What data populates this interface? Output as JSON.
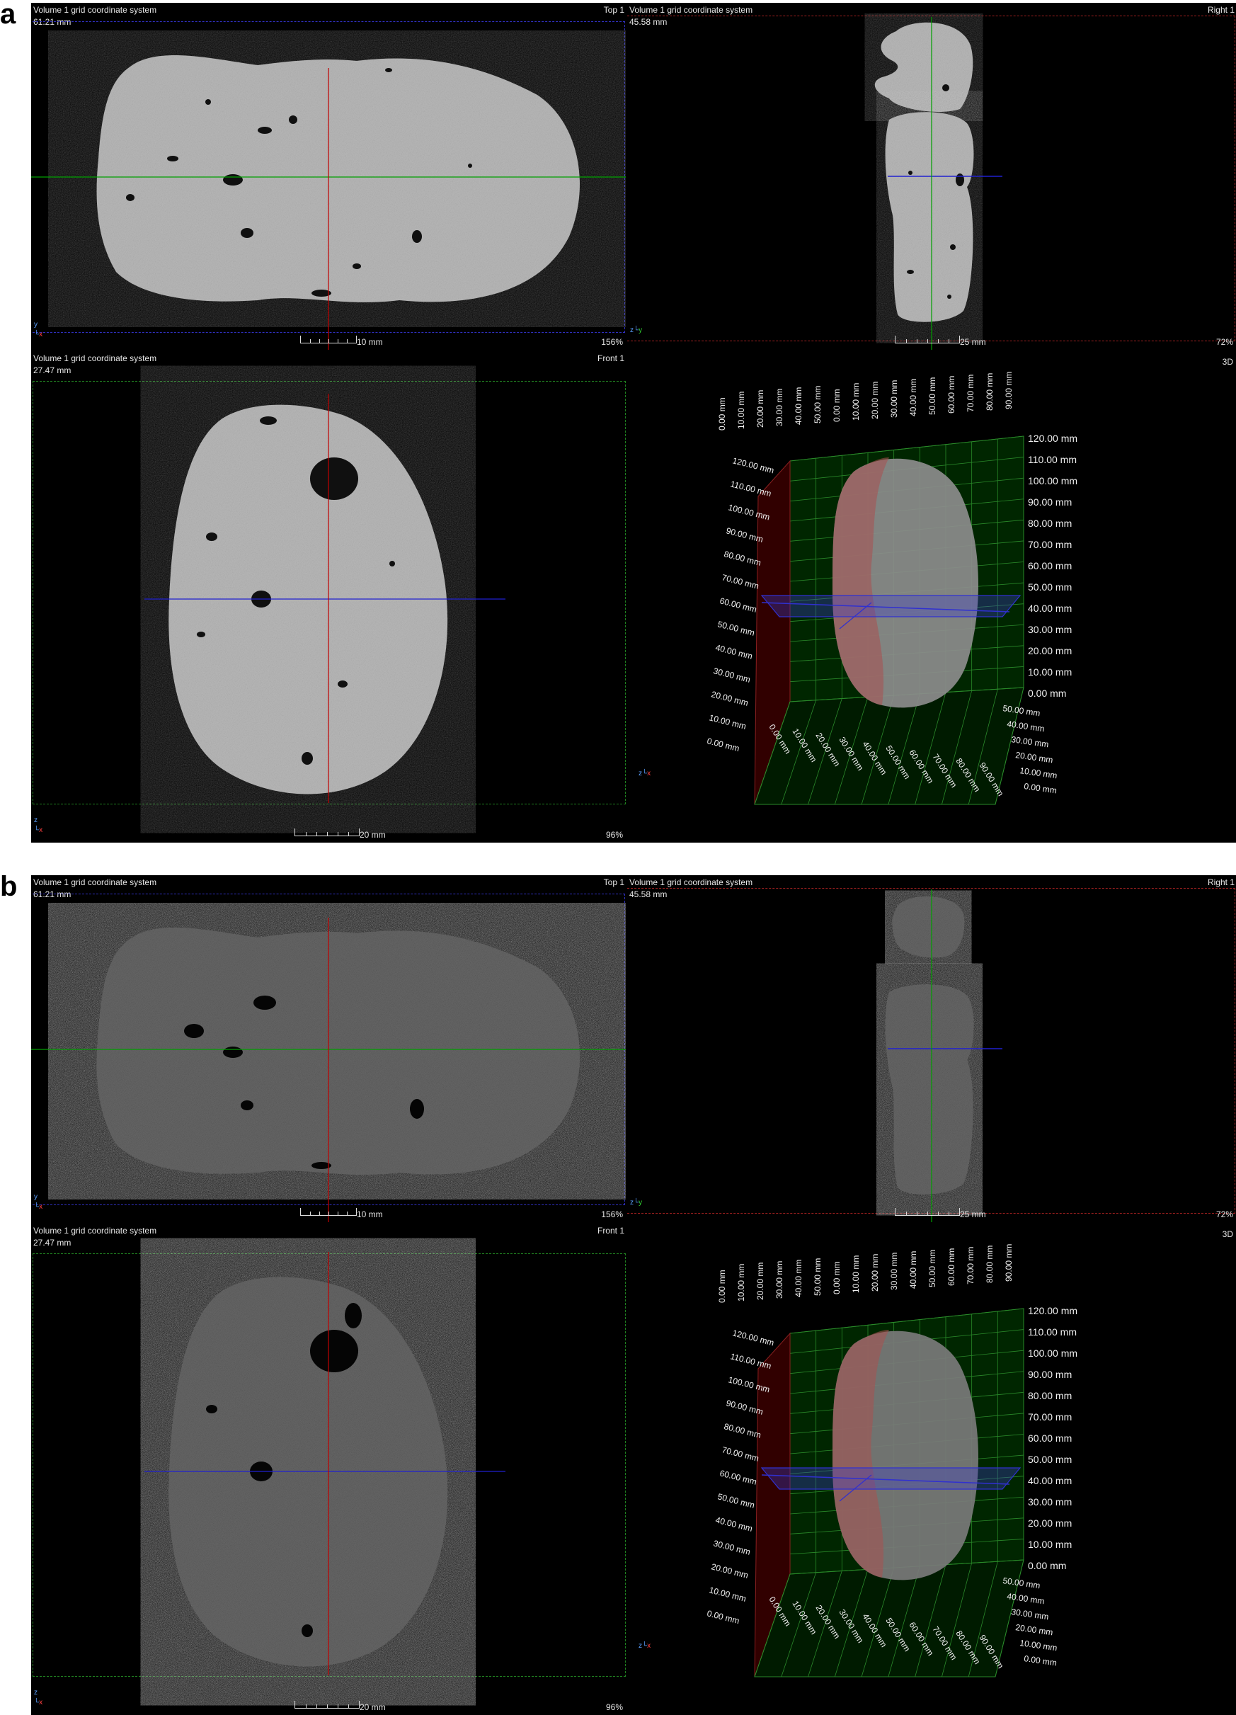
{
  "panels": [
    {
      "letter": "a",
      "top_left": {
        "title": "Volume 1 grid coordinate system",
        "dim": "61.21 mm",
        "view": "Top 1",
        "scale_label": "10 mm",
        "zoom": "156%"
      },
      "top_right": {
        "title": "Volume 1 grid coordinate system",
        "dim": "45.58 mm",
        "view": "Right 1",
        "scale_label": "25 mm",
        "zoom": "72%"
      },
      "bottom_left": {
        "title": "Volume 1 grid coordinate system",
        "dim": "27.47 mm",
        "view": "Front 1",
        "scale_label": "20 mm",
        "zoom": "96%"
      },
      "bottom_right": {
        "view": "3D"
      }
    },
    {
      "letter": "b",
      "top_left": {
        "title": "Volume 1 grid coordinate system",
        "dim": "61.21 mm",
        "view": "Top 1",
        "scale_label": "10 mm",
        "zoom": "156%"
      },
      "top_right": {
        "title": "Volume 1 grid coordinate system",
        "dim": "45.58 mm",
        "view": "Right 1",
        "scale_label": "25 mm",
        "zoom": "72%"
      },
      "bottom_left": {
        "title": "Volume 1 grid coordinate system",
        "dim": "27.47 mm",
        "view": "Front 1",
        "scale_label": "20 mm",
        "zoom": "96%"
      },
      "bottom_right": {
        "view": "3D"
      }
    }
  ],
  "grid3d": {
    "vertical_labels_right": [
      "120.00 mm",
      "110.00 mm",
      "100.00 mm",
      "90.00 mm",
      "80.00 mm",
      "70.00 mm",
      "60.00 mm",
      "50.00 mm",
      "40.00 mm",
      "30.00 mm",
      "20.00 mm",
      "10.00 mm",
      "0.00 mm"
    ],
    "vertical_labels_left": [
      "120.00 mm",
      "110.00 mm",
      "100.00 mm",
      "90.00 mm",
      "80.00 mm",
      "70.00 mm",
      "60.00 mm",
      "50.00 mm",
      "40.00 mm",
      "30.00 mm",
      "20.00 mm",
      "10.00 mm",
      "0.00 mm"
    ],
    "top_labels": [
      "0.00 mm",
      "10.00 mm",
      "20.00 mm",
      "30.00 mm",
      "40.00 mm",
      "50.00 mm",
      "0.00 mm",
      "10.00 mm",
      "20.00 mm",
      "30.00 mm",
      "40.00 mm",
      "50.00 mm",
      "60.00 mm",
      "70.00 mm",
      "80.00 mm",
      "90.00 mm"
    ],
    "depth_labels": [
      "50.00 mm",
      "40.00 mm",
      "30.00 mm",
      "20.00 mm",
      "10.00 mm",
      "0.00 mm"
    ],
    "bottom_labels": [
      "0.00 mm",
      "10.00 mm",
      "20.00 mm",
      "30.00 mm",
      "40.00 mm",
      "50.00 mm",
      "60.00 mm",
      "70.00 mm",
      "80.00 mm",
      "90.00 mm"
    ]
  },
  "colors": {
    "crosshair_red": "#c00000",
    "crosshair_green": "#00a000",
    "crosshair_blue": "#2020d0",
    "stone": "#b0b0b0"
  }
}
